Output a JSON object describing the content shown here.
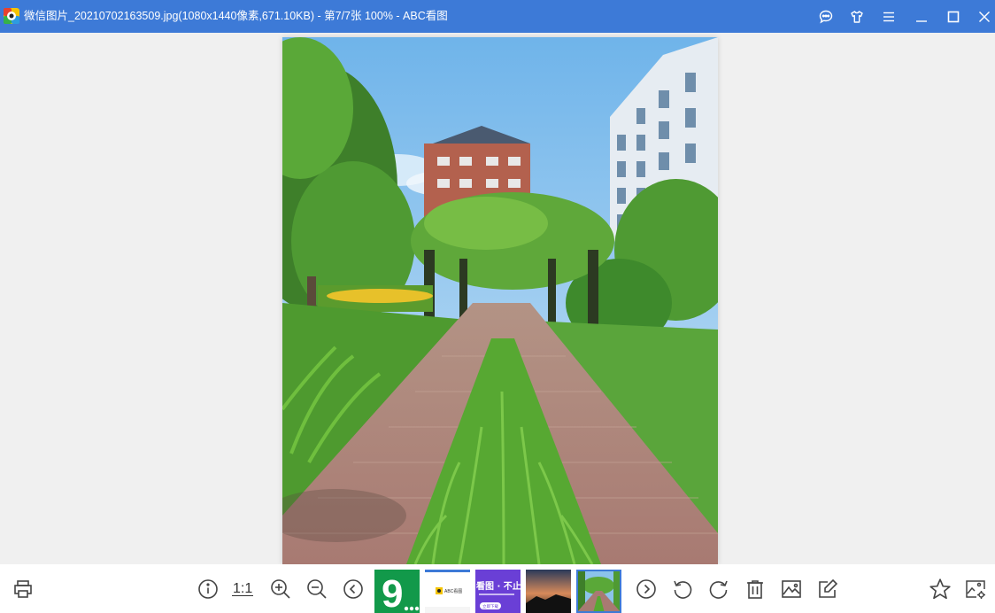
{
  "window": {
    "title": "微信图片_20210702163509.jpg(1080x1440像素,671.10KB) - 第7/7张 100% - ABC看图",
    "accent": "#3d7ad7"
  },
  "titlebar_icons": [
    "chat-icon",
    "skin-icon",
    "menu-icon",
    "minimize-icon",
    "maximize-icon",
    "close-icon"
  ],
  "toolbar": {
    "ratio_label": "1:1",
    "icons_left": [
      "print-icon",
      "info-icon",
      "zoom-in-icon",
      "zoom-out-icon",
      "prev-icon"
    ],
    "icons_right": [
      "next-icon",
      "rotate-left-icon",
      "rotate-right-icon",
      "delete-icon",
      "edit-image-icon",
      "annotate-icon",
      "favorite-icon",
      "settings-icon"
    ]
  },
  "thumbnails": {
    "count": 5,
    "active_index": 4,
    "thumb1": {
      "text": "9",
      "bg": "#12994a"
    },
    "thumb2": {
      "text": "ABC看图"
    },
    "thumb3": {
      "text_main": "看图 · 不止",
      "text_btn": "立即下载",
      "bg": "#6a3fd6"
    }
  }
}
